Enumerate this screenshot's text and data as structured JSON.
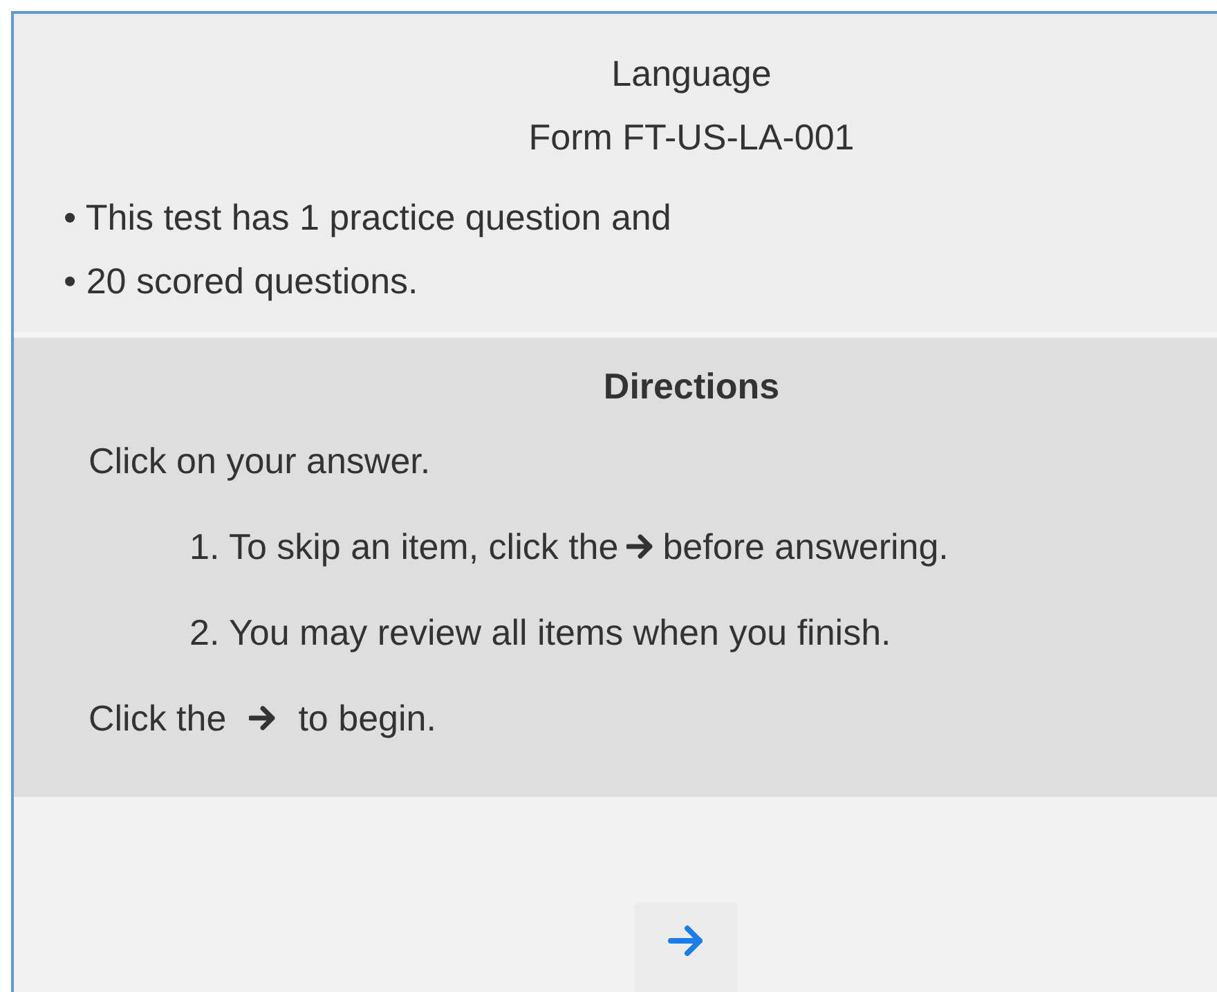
{
  "header": {
    "title": "Language",
    "form": "Form FT-US-LA-001"
  },
  "notes": [
    "• This test has 1 practice question and",
    "• 20 scored questions."
  ],
  "directions": {
    "heading": "Directions",
    "intro": "Click on your answer.",
    "steps": [
      {
        "text": "1. To skip an item, click the",
        "after": "before answering."
      },
      {
        "text": "2. You may review all items when you finish."
      }
    ],
    "closing": {
      "text": "Click the",
      "after": "to begin."
    }
  }
}
